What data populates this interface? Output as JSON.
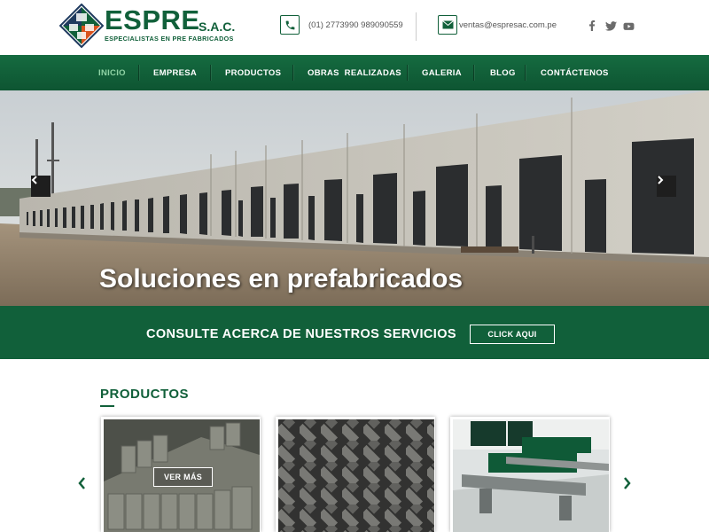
{
  "brand": {
    "name": "ESPRE",
    "suffix": "S.A.C.",
    "tagline": "ESPECIALISTAS EN PRE FABRICADOS",
    "colors": {
      "primary": "#11603a",
      "nav_active": "#8fd3a5"
    }
  },
  "contact": {
    "phone_icon": "phone-icon",
    "phones": "(01) 2773990   989090559",
    "mail_icon": "envelope-icon",
    "email": "ventas@espresac.com.pe"
  },
  "social": [
    {
      "name": "facebook-icon",
      "glyph": "f"
    },
    {
      "name": "twitter-icon",
      "glyph": "t"
    },
    {
      "name": "youtube-icon",
      "glyph": "▶"
    }
  ],
  "nav": {
    "items": [
      {
        "label": "INICIO",
        "active": true
      },
      {
        "label": "EMPRESA",
        "active": false
      },
      {
        "label": "PRODUCTOS",
        "active": false
      },
      {
        "label": "OBRAS  REALIZADAS",
        "active": false
      },
      {
        "label": "GALERIA",
        "active": false
      },
      {
        "label": "BLOG",
        "active": false
      },
      {
        "label": "CONTÁCTENOS",
        "active": false
      }
    ]
  },
  "hero": {
    "caption": "Soluciones en prefabricados",
    "prev_icon": "chevron-left-icon",
    "next_icon": "chevron-right-icon"
  },
  "cta": {
    "text": "CONSULTE ACERCA DE NUESTROS SERVICIOS",
    "button_label": "CLICK AQUI"
  },
  "products": {
    "title": "PRODUCTOS",
    "ver_mas_label": "VER MÁS",
    "prev_icon": "chevron-left-icon",
    "next_icon": "chevron-right-icon"
  }
}
